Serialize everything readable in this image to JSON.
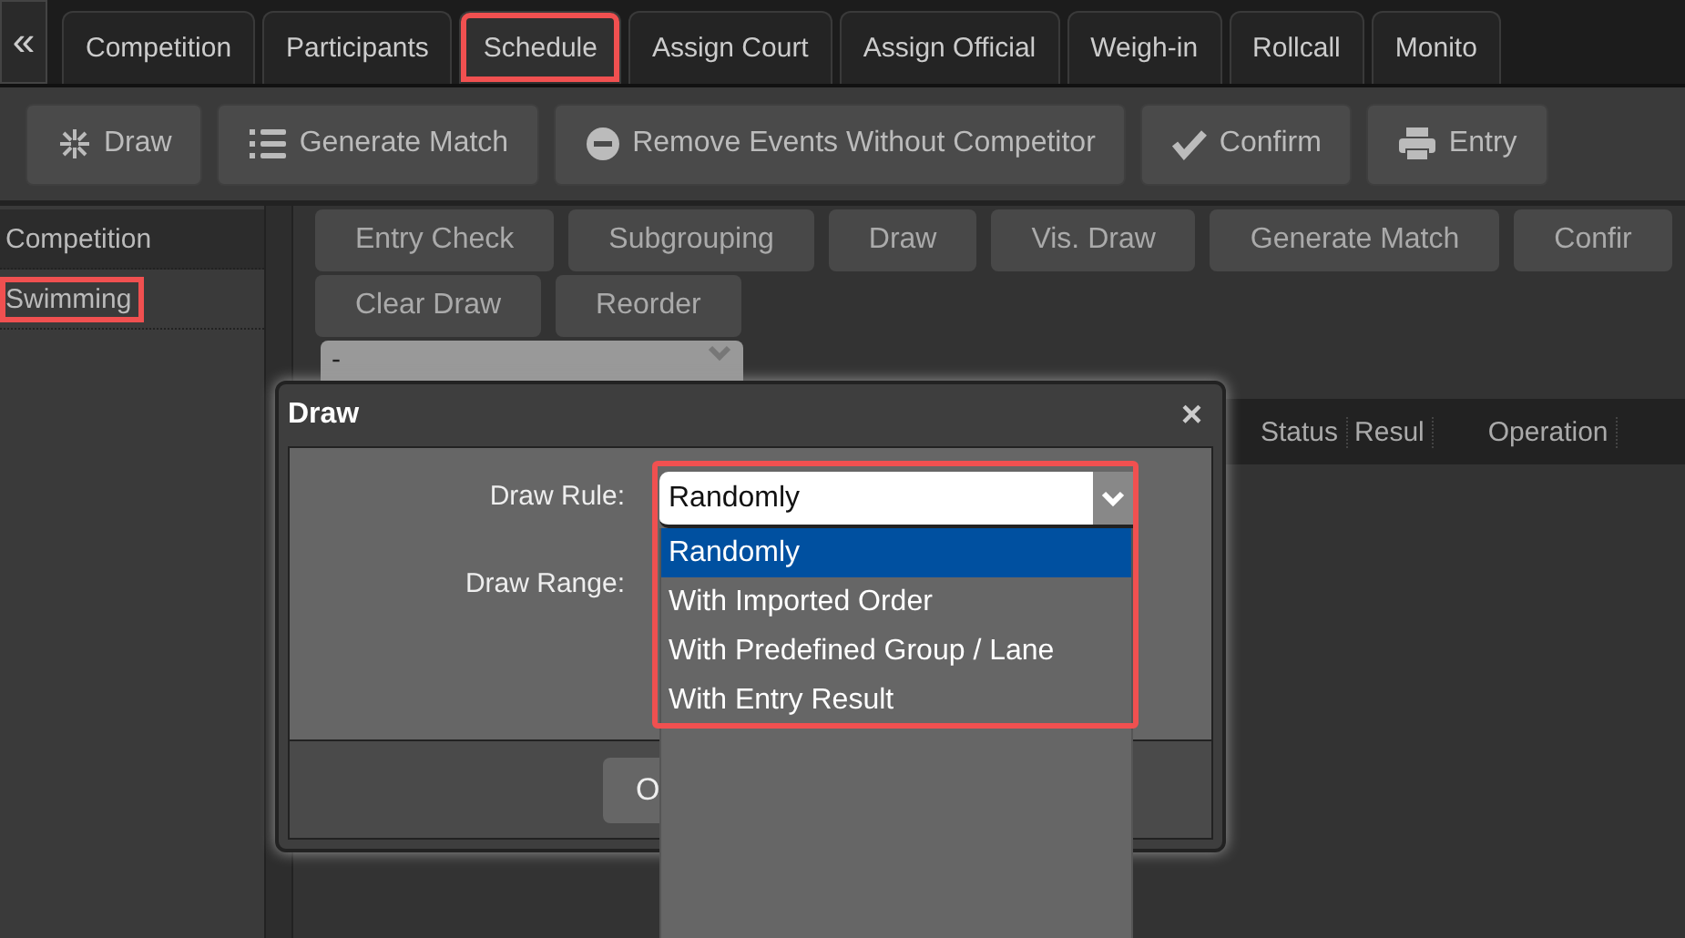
{
  "collapse": "«",
  "tabs": [
    {
      "label": "Competition",
      "selected": false,
      "highlighted": false
    },
    {
      "label": "Participants",
      "selected": false,
      "highlighted": false
    },
    {
      "label": "Schedule",
      "selected": true,
      "highlighted": true
    },
    {
      "label": "Assign Court",
      "selected": false,
      "highlighted": false
    },
    {
      "label": "Assign Official",
      "selected": false,
      "highlighted": false
    },
    {
      "label": "Weigh-in",
      "selected": false,
      "highlighted": false
    },
    {
      "label": "Rollcall",
      "selected": false,
      "highlighted": false
    },
    {
      "label": "Monito",
      "selected": false,
      "highlighted": false
    }
  ],
  "toolbar": [
    {
      "label": "Draw",
      "kind": "wand"
    },
    {
      "label": "Generate Match",
      "kind": "list"
    },
    {
      "label": "Remove Events Without Competitor",
      "kind": "minus"
    },
    {
      "label": "Confirm",
      "kind": "check"
    },
    {
      "label": "Entry",
      "kind": "printer"
    }
  ],
  "sidebar": [
    {
      "label": "Competition",
      "kind": "header",
      "highlighted": false
    },
    {
      "label": "Swimming",
      "kind": "item",
      "highlighted": true
    }
  ],
  "actions": [
    [
      "Entry Check",
      "Subgrouping",
      "Draw",
      "Vis. Draw",
      "Generate Match",
      "Confir"
    ],
    [
      "Clear Draw",
      "Reorder"
    ]
  ],
  "event_select": {
    "value": "-"
  },
  "table": {
    "columns": [
      "Status",
      "Resul",
      "Operation"
    ]
  },
  "dialog": {
    "title": "Draw",
    "close": "×",
    "fields": [
      {
        "label": "Draw Rule:"
      },
      {
        "label": "Draw Range:"
      }
    ],
    "draw_rule": {
      "value": "Randomly",
      "highlighted": true,
      "options": [
        {
          "label": "Randomly",
          "selected": true
        },
        {
          "label": "With Imported Order",
          "selected": false
        },
        {
          "label": "With Predefined Group / Lane",
          "selected": false
        },
        {
          "label": "With Entry Result",
          "selected": false
        }
      ]
    },
    "buttons": [
      "O"
    ]
  }
}
